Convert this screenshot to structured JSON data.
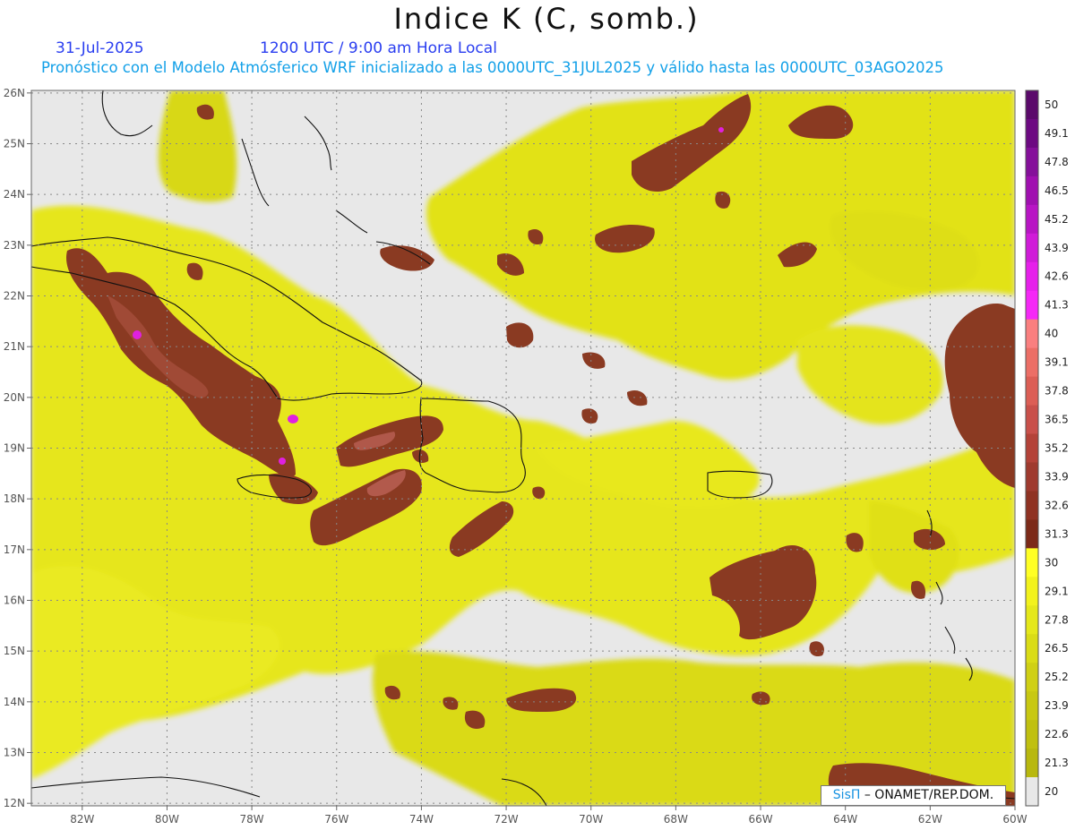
{
  "title": "Indice K (C, somb.)",
  "date": "31-Jul-2025",
  "time": "1200 UTC / 9:00 am Hora Local",
  "subtitle": "Pronóstico con el Modelo Atmósferico WRF inicializado a las 0000UTC_31JUL2025 y válido hasta las  0000UTC_03AGO2025",
  "credit": {
    "brand": "SisΠ",
    "text": " – ONAMET/REP.DOM."
  },
  "map": {
    "lat_labels": [
      "26N",
      "25N",
      "24N",
      "23N",
      "22N",
      "21N",
      "20N",
      "19N",
      "18N",
      "17N",
      "16N",
      "15N",
      "14N",
      "13N",
      "12N"
    ],
    "lon_labels": [
      "82W",
      "80W",
      "78W",
      "76W",
      "74W",
      "72W",
      "70W",
      "68W",
      "66W",
      "64W",
      "62W",
      "60W"
    ],
    "lat_range": [
      12,
      26
    ],
    "lon_range": [
      -83.2,
      -60
    ],
    "grid": true
  },
  "colorbar": {
    "labels": [
      "50",
      "49.1",
      "47.8",
      "46.5",
      "45.2",
      "43.9",
      "42.6",
      "41.3",
      "40",
      "39.1",
      "37.8",
      "36.5",
      "35.2",
      "33.9",
      "32.6",
      "31.3",
      "30",
      "29.1",
      "27.8",
      "26.5",
      "25.2",
      "23.9",
      "22.6",
      "21.3",
      "20"
    ],
    "colors": [
      "#5b0a6b",
      "#6d0a82",
      "#85109a",
      "#a010b0",
      "#b815c4",
      "#d01cd8",
      "#e620ea",
      "#f528f6",
      "#fa7f7f",
      "#ec6e66",
      "#dc5e55",
      "#c9504a",
      "#b44238",
      "#9f3a2e",
      "#8f3222",
      "#7c2a18",
      "#ffff24",
      "#f2f21c",
      "#e5e81a",
      "#dadc16",
      "#d0d014",
      "#c8c812",
      "#c0c010",
      "#b8b80e",
      "#e8e8e8"
    ]
  }
}
